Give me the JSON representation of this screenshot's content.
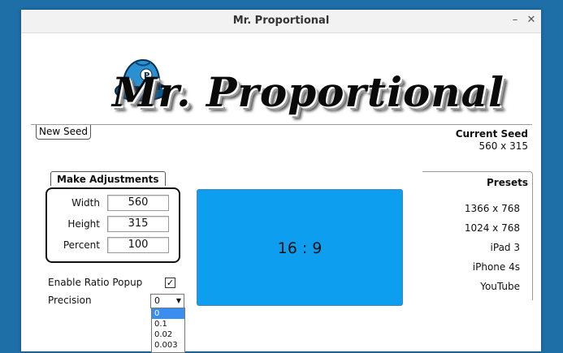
{
  "window": {
    "title": "Mr. Proportional"
  },
  "logo": {
    "text": "Mr. Proportional",
    "hat_letter": "P"
  },
  "seed": {
    "new_seed_label": "New Seed",
    "current_seed_label": "Current Seed",
    "current_seed_value": "560 x 315"
  },
  "adjustments": {
    "tab_label": "Make Adjustments",
    "width_label": "Width",
    "width_value": "560",
    "height_label": "Height",
    "height_value": "315",
    "percent_label": "Percent",
    "percent_value": "100"
  },
  "ratio": {
    "text": "16 : 9",
    "color": "#0e9ef0"
  },
  "presets": {
    "label": "Presets",
    "items": [
      "1366 x 768",
      "1024 x 768",
      "iPad 3",
      "iPhone 4s",
      "YouTube"
    ]
  },
  "options": {
    "ratio_popup_label": "Enable Ratio Popup",
    "ratio_popup_checked": true,
    "precision_label": "Precision",
    "precision_value": "0",
    "precision_options": [
      "0",
      "0.1",
      "0.02",
      "0.003"
    ]
  }
}
